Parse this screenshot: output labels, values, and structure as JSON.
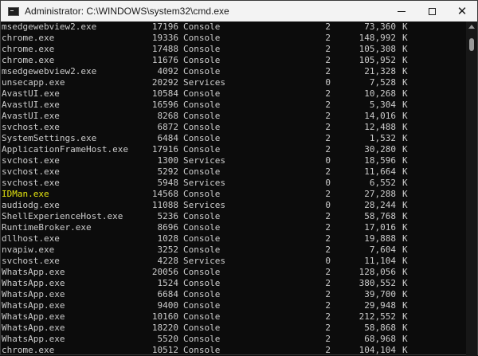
{
  "window": {
    "title": "Administrator: C:\\WINDOWS\\system32\\cmd.exe"
  },
  "controls": {
    "min_icon": "minimize-icon",
    "max_icon": "maximize-icon",
    "close_icon": "close-icon",
    "close_glyph": "✕"
  },
  "colors": {
    "background": "#0c0c0c",
    "text": "#cccccc",
    "highlight": "#e5e510",
    "titlebar": "#f3f3f3"
  },
  "processes": [
    {
      "name": "msedgewebview2.exe",
      "pid": "17196",
      "session": "Console",
      "num": "2",
      "mem": "73,360",
      "unit": "K"
    },
    {
      "name": "chrome.exe",
      "pid": "19336",
      "session": "Console",
      "num": "2",
      "mem": "148,992",
      "unit": "K"
    },
    {
      "name": "chrome.exe",
      "pid": "17488",
      "session": "Console",
      "num": "2",
      "mem": "105,308",
      "unit": "K"
    },
    {
      "name": "chrome.exe",
      "pid": "11676",
      "session": "Console",
      "num": "2",
      "mem": "105,952",
      "unit": "K"
    },
    {
      "name": "msedgewebview2.exe",
      "pid": "4092",
      "session": "Console",
      "num": "2",
      "mem": "21,328",
      "unit": "K"
    },
    {
      "name": "unsecapp.exe",
      "pid": "20292",
      "session": "Services",
      "num": "0",
      "mem": "7,528",
      "unit": "K"
    },
    {
      "name": "AvastUI.exe",
      "pid": "10584",
      "session": "Console",
      "num": "2",
      "mem": "10,268",
      "unit": "K"
    },
    {
      "name": "AvastUI.exe",
      "pid": "16596",
      "session": "Console",
      "num": "2",
      "mem": "5,304",
      "unit": "K"
    },
    {
      "name": "AvastUI.exe",
      "pid": "8268",
      "session": "Console",
      "num": "2",
      "mem": "14,016",
      "unit": "K"
    },
    {
      "name": "svchost.exe",
      "pid": "6872",
      "session": "Console",
      "num": "2",
      "mem": "12,488",
      "unit": "K"
    },
    {
      "name": "SystemSettings.exe",
      "pid": "6484",
      "session": "Console",
      "num": "2",
      "mem": "1,532",
      "unit": "K"
    },
    {
      "name": "ApplicationFrameHost.exe",
      "pid": "17916",
      "session": "Console",
      "num": "2",
      "mem": "30,280",
      "unit": "K"
    },
    {
      "name": "svchost.exe",
      "pid": "1300",
      "session": "Services",
      "num": "0",
      "mem": "18,596",
      "unit": "K"
    },
    {
      "name": "svchost.exe",
      "pid": "5292",
      "session": "Console",
      "num": "2",
      "mem": "11,664",
      "unit": "K"
    },
    {
      "name": "svchost.exe",
      "pid": "5948",
      "session": "Services",
      "num": "0",
      "mem": "6,552",
      "unit": "K"
    },
    {
      "name": "IDMan.exe",
      "pid": "14568",
      "session": "Console",
      "num": "2",
      "mem": "27,288",
      "unit": "K"
    },
    {
      "name": "audiodg.exe",
      "pid": "11088",
      "session": "Services",
      "num": "0",
      "mem": "28,244",
      "unit": "K"
    },
    {
      "name": "ShellExperienceHost.exe",
      "pid": "5236",
      "session": "Console",
      "num": "2",
      "mem": "58,768",
      "unit": "K"
    },
    {
      "name": "RuntimeBroker.exe",
      "pid": "8696",
      "session": "Console",
      "num": "2",
      "mem": "17,016",
      "unit": "K"
    },
    {
      "name": "dllhost.exe",
      "pid": "1028",
      "session": "Console",
      "num": "2",
      "mem": "19,888",
      "unit": "K"
    },
    {
      "name": "nvapiw.exe",
      "pid": "3252",
      "session": "Console",
      "num": "2",
      "mem": "7,604",
      "unit": "K"
    },
    {
      "name": "svchost.exe",
      "pid": "4228",
      "session": "Services",
      "num": "0",
      "mem": "11,104",
      "unit": "K"
    },
    {
      "name": "WhatsApp.exe",
      "pid": "20056",
      "session": "Console",
      "num": "2",
      "mem": "128,056",
      "unit": "K"
    },
    {
      "name": "WhatsApp.exe",
      "pid": "1524",
      "session": "Console",
      "num": "2",
      "mem": "380,552",
      "unit": "K"
    },
    {
      "name": "WhatsApp.exe",
      "pid": "6684",
      "session": "Console",
      "num": "2",
      "mem": "39,700",
      "unit": "K"
    },
    {
      "name": "WhatsApp.exe",
      "pid": "9400",
      "session": "Console",
      "num": "2",
      "mem": "29,948",
      "unit": "K"
    },
    {
      "name": "WhatsApp.exe",
      "pid": "10160",
      "session": "Console",
      "num": "2",
      "mem": "212,552",
      "unit": "K"
    },
    {
      "name": "WhatsApp.exe",
      "pid": "18220",
      "session": "Console",
      "num": "2",
      "mem": "58,868",
      "unit": "K"
    },
    {
      "name": "WhatsApp.exe",
      "pid": "5520",
      "session": "Console",
      "num": "2",
      "mem": "68,968",
      "unit": "K"
    },
    {
      "name": "chrome.exe",
      "pid": "10512",
      "session": "Console",
      "num": "2",
      "mem": "104,104",
      "unit": "K"
    }
  ],
  "highlighted_process": "IDMan.exe"
}
